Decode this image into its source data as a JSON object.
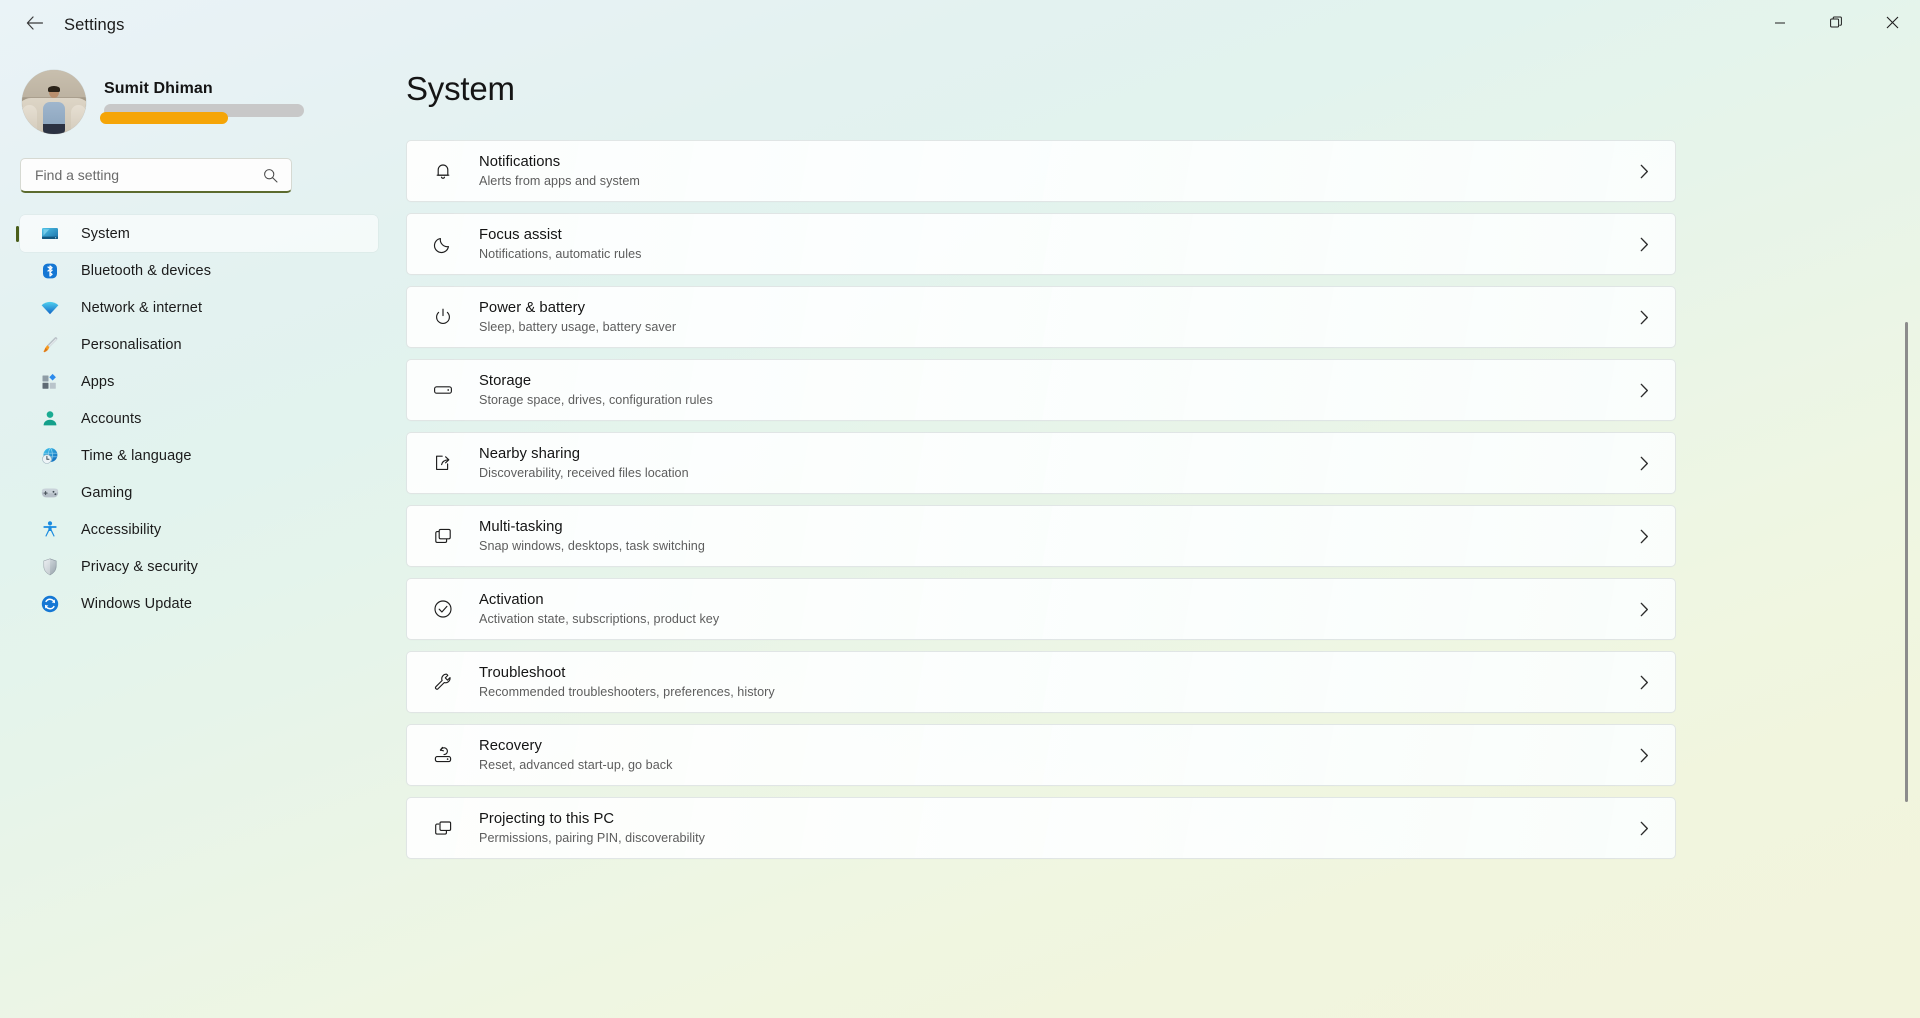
{
  "window": {
    "title": "Settings",
    "back_icon": "arrow-left-icon",
    "controls": [
      {
        "name": "minimise-button",
        "icon": "minimise-icon"
      },
      {
        "name": "maximise-button",
        "icon": "restore-icon"
      },
      {
        "name": "close-button",
        "icon": "close-icon"
      }
    ]
  },
  "profile": {
    "name": "Sumit Dhiman",
    "avatar_alt": "user-avatar-photo",
    "email_redacted": true
  },
  "search": {
    "placeholder": "Find a setting",
    "value": "",
    "icon": "search-icon"
  },
  "sidebar": {
    "items": [
      {
        "label": "System",
        "icon": "monitor-icon",
        "selected": true
      },
      {
        "label": "Bluetooth & devices",
        "icon": "bluetooth-icon",
        "selected": false
      },
      {
        "label": "Network & internet",
        "icon": "wifi-icon",
        "selected": false
      },
      {
        "label": "Personalisation",
        "icon": "paintbrush-icon",
        "selected": false
      },
      {
        "label": "Apps",
        "icon": "apps-icon",
        "selected": false
      },
      {
        "label": "Accounts",
        "icon": "person-icon",
        "selected": false
      },
      {
        "label": "Time & language",
        "icon": "globe-clock-icon",
        "selected": false
      },
      {
        "label": "Gaming",
        "icon": "gamepad-icon",
        "selected": false
      },
      {
        "label": "Accessibility",
        "icon": "accessibility-icon",
        "selected": false
      },
      {
        "label": "Privacy & security",
        "icon": "shield-icon",
        "selected": false
      },
      {
        "label": "Windows Update",
        "icon": "update-icon",
        "selected": false
      }
    ]
  },
  "main": {
    "page_title": "System",
    "chevron_icon": "chevron-right-icon",
    "cards": [
      {
        "title": "Notifications",
        "sub": "Alerts from apps and system",
        "icon": "bell-icon"
      },
      {
        "title": "Focus assist",
        "sub": "Notifications, automatic rules",
        "icon": "moon-icon"
      },
      {
        "title": "Power & battery",
        "sub": "Sleep, battery usage, battery saver",
        "icon": "power-icon"
      },
      {
        "title": "Storage",
        "sub": "Storage space, drives, configuration rules",
        "icon": "drive-icon"
      },
      {
        "title": "Nearby sharing",
        "sub": "Discoverability, received files location",
        "icon": "share-icon"
      },
      {
        "title": "Multi-tasking",
        "sub": "Snap windows, desktops, task switching",
        "icon": "windows-stack-icon"
      },
      {
        "title": "Activation",
        "sub": "Activation state, subscriptions, product key",
        "icon": "check-circle-icon"
      },
      {
        "title": "Troubleshoot",
        "sub": "Recommended troubleshooters, preferences, history",
        "icon": "wrench-icon"
      },
      {
        "title": "Recovery",
        "sub": "Reset, advanced start-up, go back",
        "icon": "recovery-icon"
      },
      {
        "title": "Projecting to this PC",
        "sub": "Permissions, pairing PIN, discoverability",
        "icon": "project-screen-icon"
      }
    ]
  },
  "colors": {
    "accent_selected_bar": "#4a5e1a",
    "search_underline": "#5c6b2e",
    "highlight_marker": "#f5a507",
    "redaction": "#c8c8c8"
  }
}
